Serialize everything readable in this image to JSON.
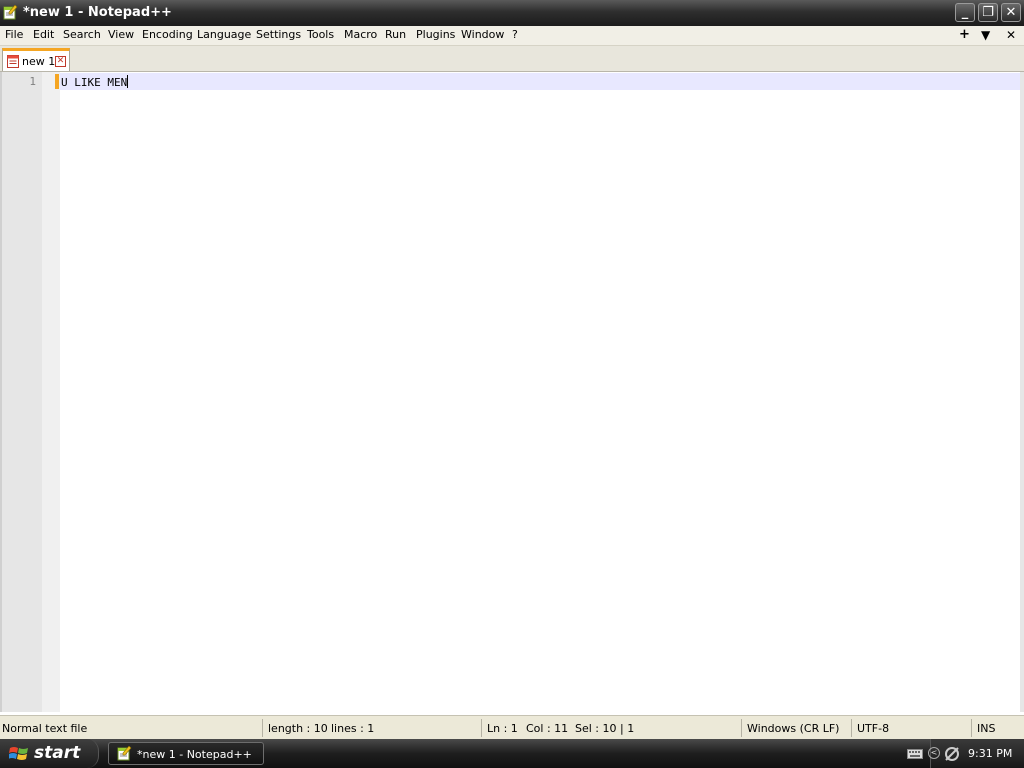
{
  "window": {
    "title": "*new 1 - Notepad++",
    "controls": {
      "minimize": "_",
      "maximize": "❐",
      "close": "✕"
    }
  },
  "menu": {
    "items": [
      "File",
      "Edit",
      "Search",
      "View",
      "Encoding",
      "Language",
      "Settings",
      "Tools",
      "Macro",
      "Run",
      "Plugins",
      "Window",
      "?"
    ],
    "right": {
      "add": "+",
      "dropdown": "▼",
      "close": "✕"
    }
  },
  "tabs": [
    {
      "label": "new 1",
      "close": "✕",
      "icon": "document-icon",
      "modified": true
    }
  ],
  "editor": {
    "line_number": "1",
    "text": "U LIKE MEN"
  },
  "status_bar": {
    "file_type": "Normal text file",
    "length": "length : 10",
    "lines": "lines : 1",
    "ln": "Ln : 1",
    "col": "Col : 11",
    "sel": "Sel : 10 | 1",
    "eol": "Windows (CR LF)",
    "encoding": "UTF-8",
    "mode": "INS"
  },
  "taskbar": {
    "start_label": "start",
    "active_item": "*new 1 - Notepad++",
    "clock": "9:31 PM"
  },
  "colors": {
    "title_bar": "#2e2e2e",
    "menu_bar": "#f1efe6",
    "active_tab_accent": "#f5a623",
    "current_line": "#e8e8ff",
    "gutter": "#e6e6e6",
    "status_bar": "#ece9d8",
    "taskbar": "#1e1e1e"
  }
}
